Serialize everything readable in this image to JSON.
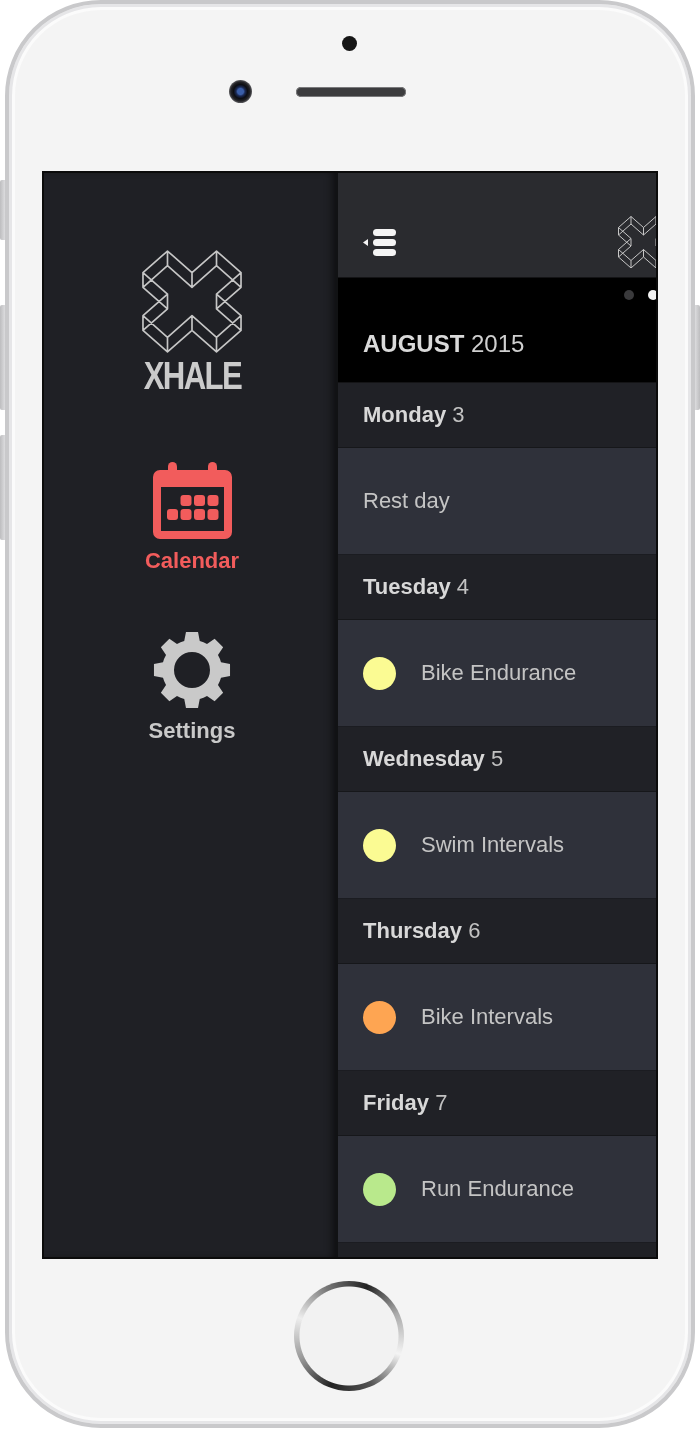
{
  "sidebar": {
    "logo_text": "XHALE",
    "items": [
      {
        "kind": "calendar",
        "label": "Calendar",
        "selected": true
      },
      {
        "kind": "settings",
        "label": "Settings",
        "selected": false
      }
    ]
  },
  "pager": [
    {
      "selected": false
    },
    {
      "selected": true
    }
  ],
  "month": "**AUGUST** 2015",
  "days": [
    {
      "title": "**Monday** 3",
      "events": [
        {
          "kind": "rest",
          "name": "Rest day"
        }
      ]
    },
    {
      "title": "**Tuesday** 4",
      "events": [
        {
          "kind": "workout",
          "name": "Bike Endurance",
          "color": "#fbfb93"
        }
      ]
    },
    {
      "title": "**Wednesday** 5",
      "events": [
        {
          "kind": "workout",
          "name": "Swim Intervals",
          "color": "#fbfb93"
        }
      ]
    },
    {
      "title": "**Thursday** 6",
      "events": [
        {
          "kind": "workout",
          "name": "Bike Intervals",
          "color": "#fea552"
        }
      ]
    },
    {
      "title": "**Friday** 7",
      "events": [
        {
          "kind": "workout",
          "name": "Run Endurance",
          "color": "#b9e98c"
        }
      ]
    }
  ]
}
